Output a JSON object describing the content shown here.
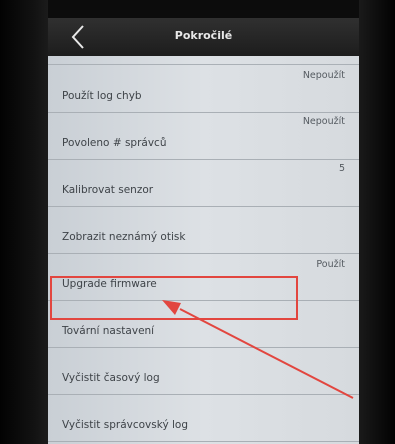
{
  "header": {
    "title": "Pokročilé",
    "back_icon": "chevron-left-icon"
  },
  "items": [
    {
      "label": "Použít log chyb",
      "value": "Nepoužít"
    },
    {
      "label": "Povoleno # správců",
      "value": "Nepoužít"
    },
    {
      "label": "Kalibrovat senzor",
      "value": "5"
    },
    {
      "label": "Zobrazit neznámý otisk",
      "value": ""
    },
    {
      "label": "Upgrade firmware",
      "value": "Použít"
    },
    {
      "label": "Tovární nastavení",
      "value": ""
    },
    {
      "label": "Vyčistit časový log",
      "value": ""
    },
    {
      "label": "Vyčistit správcovský log",
      "value": ""
    }
  ],
  "colors": {
    "annotation": "#e2463f",
    "header": "#262626",
    "list_bg": "#d6dbe0"
  }
}
